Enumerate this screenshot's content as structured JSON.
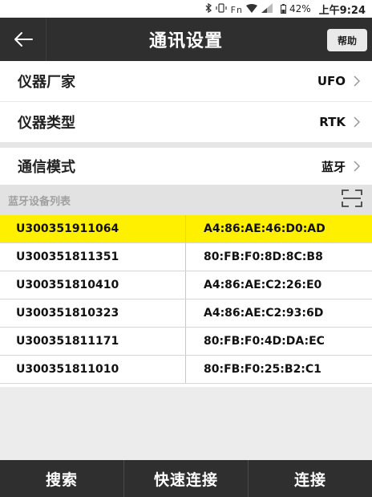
{
  "status_bar": {
    "icons": [
      "bluetooth-icon",
      "vibrate-icon",
      "wifi-icon",
      "signal-icon",
      "battery-icon"
    ],
    "fn_label": "Fn",
    "battery": "42%",
    "time": "上午9:24"
  },
  "header": {
    "title": "通讯设置",
    "help_label": "帮助",
    "background": "#2f2f2f"
  },
  "settings": [
    {
      "label": "仪器厂家",
      "value": "UFO"
    },
    {
      "label": "仪器类型",
      "value": "RTK"
    },
    {
      "label": "通信模式",
      "value": "蓝牙"
    }
  ],
  "device_list": {
    "title": "蓝牙设备列表",
    "selected_color": "#fff000",
    "devices": [
      {
        "name": "U300351911064",
        "mac": "A4:86:AE:46:D0:AD",
        "selected": true
      },
      {
        "name": "U300351811351",
        "mac": "80:FB:F0:8D:8C:B8",
        "selected": false
      },
      {
        "name": "U300351810410",
        "mac": "A4:86:AE:C2:26:E0",
        "selected": false
      },
      {
        "name": "U300351810323",
        "mac": "A4:86:AE:C2:93:6D",
        "selected": false
      },
      {
        "name": "U300351811171",
        "mac": "80:FB:F0:4D:DA:EC",
        "selected": false
      },
      {
        "name": "U300351811010",
        "mac": "80:FB:F0:25:B2:C1",
        "selected": false
      }
    ]
  },
  "bottom_actions": {
    "search_label": "搜索",
    "quick_connect_label": "快速连接",
    "connect_label": "连接"
  }
}
